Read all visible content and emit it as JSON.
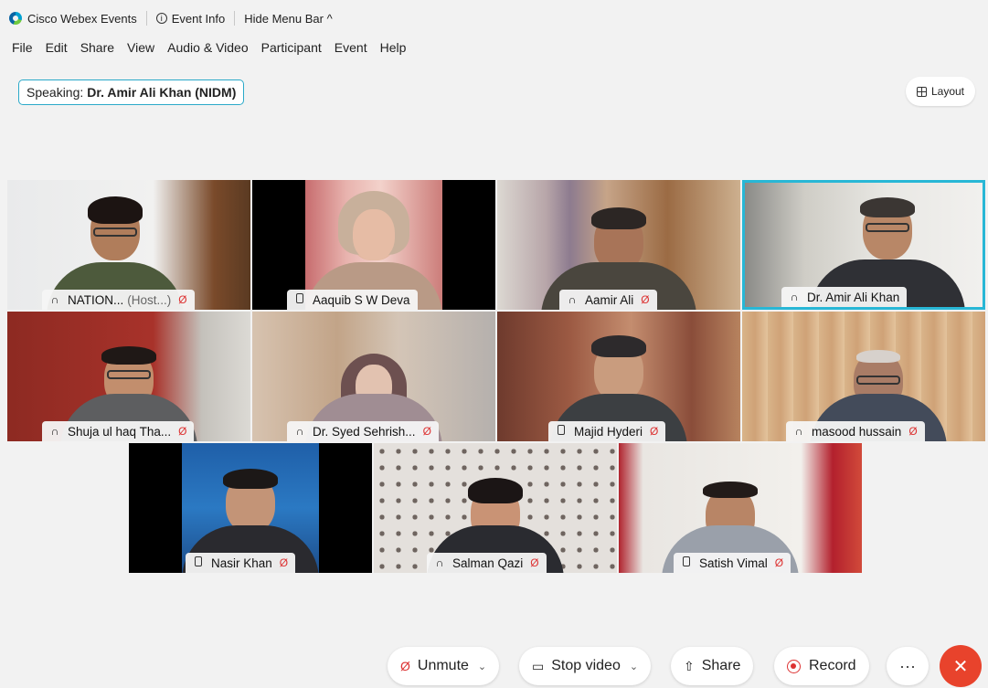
{
  "titlebar": {
    "app_name": "Cisco Webex Events",
    "event_info": "Event Info",
    "hide_menu": "Hide Menu Bar ^"
  },
  "menu": {
    "items": [
      "File",
      "Edit",
      "Share",
      "View",
      "Audio & Video",
      "Participant",
      "Event",
      "Help"
    ]
  },
  "speaking": {
    "label": "Speaking:",
    "name": "Dr. Amir Ali Khan (NIDM)"
  },
  "layout_label": "Layout",
  "participants": [
    {
      "name": "NATION...",
      "host": "(Host...)",
      "device": "audio-icon",
      "muted": true
    },
    {
      "name": "Aaquib S W Deva",
      "device": "phone-icon",
      "muted": false
    },
    {
      "name": "Aamir Ali",
      "device": "audio-icon",
      "muted": true
    },
    {
      "name": "Dr. Amir Ali Khan",
      "device": "audio-icon",
      "muted": false,
      "active_speaker": true
    },
    {
      "name": "Shuja ul haq Tha...",
      "device": "audio-icon",
      "muted": true
    },
    {
      "name": "Dr. Syed Sehrish...",
      "device": "audio-icon",
      "muted": true
    },
    {
      "name": "Majid Hyderi",
      "device": "phone-icon",
      "muted": true
    },
    {
      "name": "masood hussain",
      "device": "audio-icon",
      "muted": true
    },
    {
      "name": "Nasir Khan",
      "device": "phone-icon",
      "muted": true
    },
    {
      "name": "Salman Qazi",
      "device": "audio-icon",
      "muted": true
    },
    {
      "name": "Satish Vimal",
      "device": "phone-icon",
      "muted": true
    }
  ],
  "controls": {
    "unmute": "Unmute",
    "stop_video": "Stop video",
    "share": "Share",
    "record": "Record",
    "more": "···",
    "end": "✕"
  },
  "colors": {
    "accent": "#2aa9c9",
    "end_call": "#e8432c",
    "muted_red": "#dd3333"
  }
}
